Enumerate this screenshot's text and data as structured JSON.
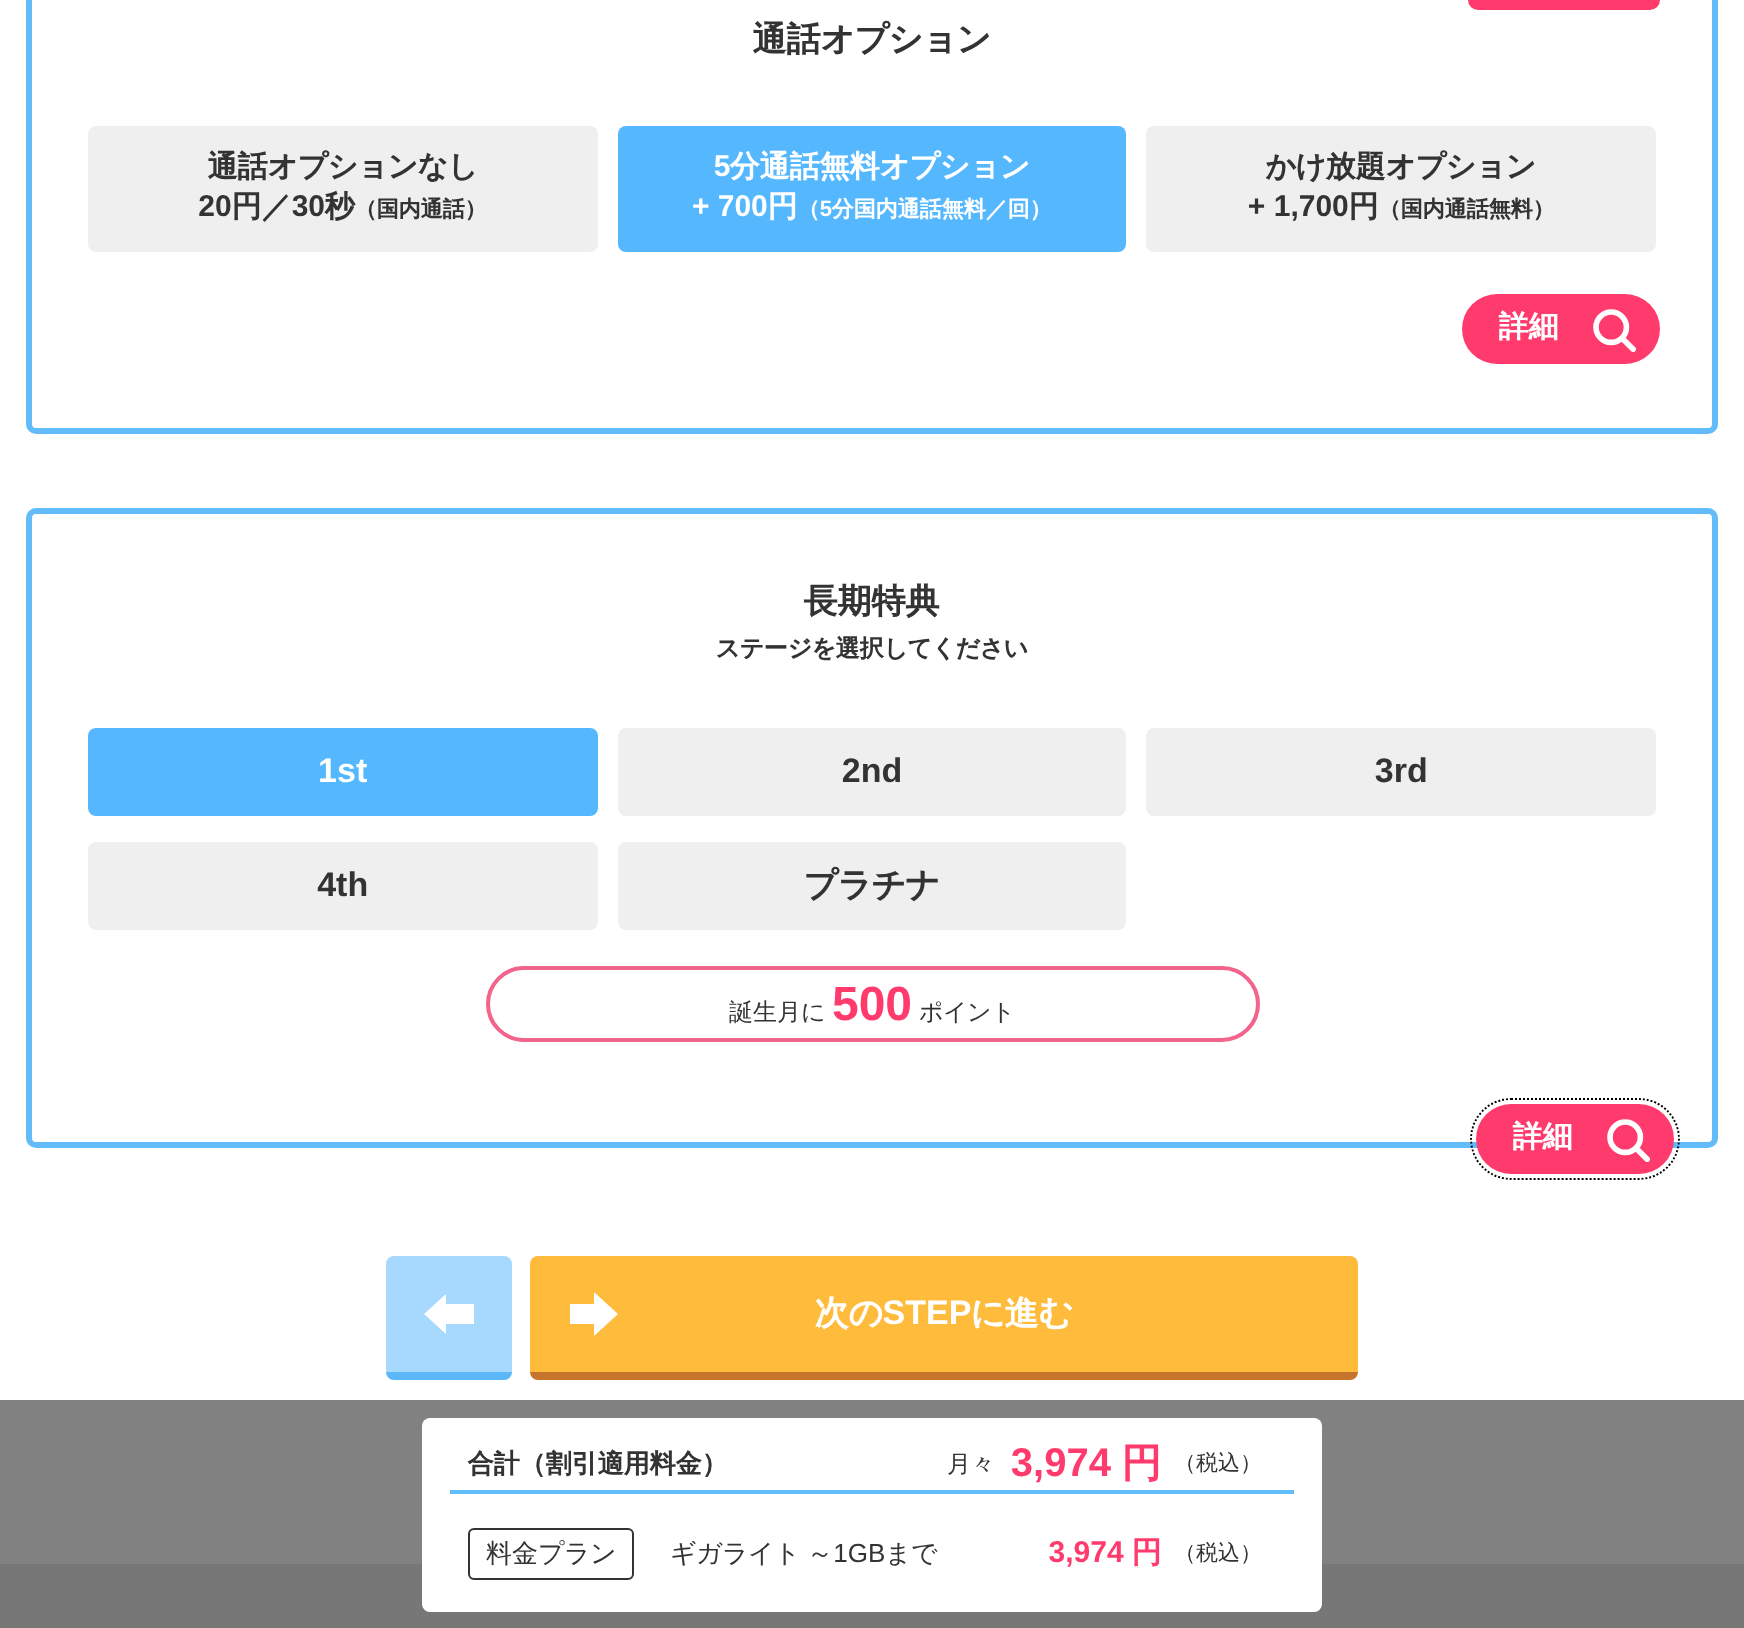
{
  "call_options": {
    "title": "通話オプション",
    "options": [
      {
        "name": "通話オプションなし",
        "price": "20円／30秒",
        "note": "（国内通話）",
        "selected": false
      },
      {
        "name": "5分通話無料オプション",
        "price": "+ 700円",
        "note": "（5分国内通話無料／回）",
        "selected": true
      },
      {
        "name": "かけ放題オプション",
        "price": "+ 1,700円",
        "note": "（国内通話無料）",
        "selected": false
      }
    ],
    "detail_button": {
      "label": "詳細",
      "focused": false
    }
  },
  "long_term_benefit": {
    "title": "長期特典",
    "subtitle": "ステージを選択してください",
    "stages": [
      {
        "label": "1st",
        "selected": true
      },
      {
        "label": "2nd",
        "selected": false
      },
      {
        "label": "3rd",
        "selected": false
      },
      {
        "label": "4th",
        "selected": false
      },
      {
        "label": "プラチナ",
        "selected": false
      }
    ],
    "reward": {
      "prefix": "誕生月に",
      "amount": "500",
      "suffix": "ポイント"
    },
    "detail_button": {
      "label": "詳細",
      "focused": true
    }
  },
  "navigation": {
    "next_button": {
      "label": "次のSTEPに進む"
    }
  },
  "summary": {
    "total_label": "合計（割引適用料金）",
    "monthly_prefix": "月々",
    "total_amount": "3,974 円",
    "tax_note": "（税込）",
    "items": [
      {
        "tag": "料金プラン",
        "name": "ギガライト ～1GBまで",
        "amount": "3,974 円",
        "tax_note": "（税込）"
      }
    ]
  }
}
